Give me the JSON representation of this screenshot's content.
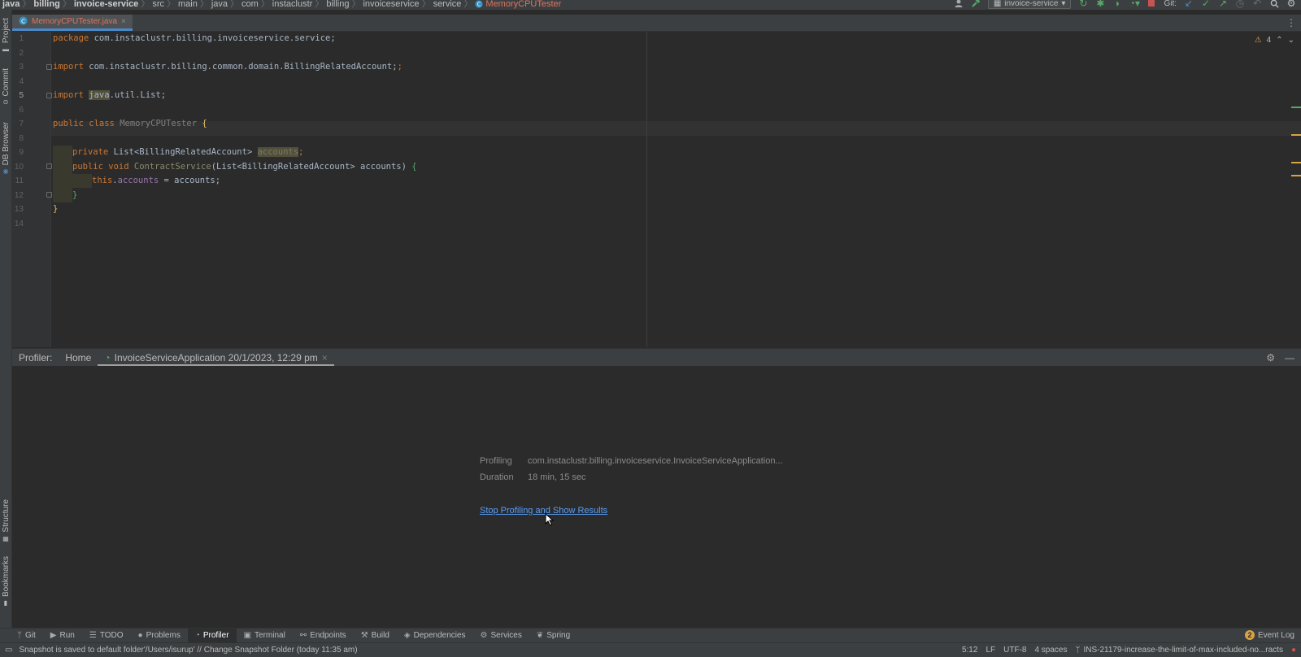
{
  "breadcrumb": [
    {
      "label": "java",
      "bold": true
    },
    {
      "label": "billing",
      "bold": true
    },
    {
      "label": "invoice-service",
      "bold": true
    },
    {
      "label": "src",
      "bold": false
    },
    {
      "label": "main",
      "bold": false
    },
    {
      "label": "java",
      "bold": false
    },
    {
      "label": "com",
      "bold": false
    },
    {
      "label": "instaclustr",
      "bold": false
    },
    {
      "label": "billing",
      "bold": false
    },
    {
      "label": "invoiceservice",
      "bold": false
    },
    {
      "label": "service",
      "bold": false
    }
  ],
  "breadcrumb_current": "MemoryCPUTester",
  "toolbar": {
    "run_config": "invoice-service",
    "git_label": "Git:"
  },
  "left_tabs": [
    "Project",
    "Commit",
    "DB Browser",
    "Structure",
    "Bookmarks"
  ],
  "editor_tab": {
    "name": "MemoryCPUTester.java",
    "close": "×"
  },
  "editor": {
    "warnings_count": "4",
    "current_line": 5,
    "line_numbers": [
      "1",
      "2",
      "3",
      "4",
      "5",
      "6",
      "7",
      "8",
      "9",
      "10",
      "11",
      "12",
      "13",
      "14"
    ]
  },
  "code": {
    "l1_kw": "package",
    "l1_rest": " com.instaclustr.billing.invoiceservice.service;",
    "l3_kw": "import",
    "l3_rest": " com.instaclustr.billing.common.domain.BillingRelatedAccount;",
    "l5_kw": "import",
    "l5_pkg": "java",
    "l5_rest": ".util.List;",
    "l7_kw": "public class",
    "l7_name": "MemoryCPUTester",
    "l7_brace": "{",
    "l9_kw": "private",
    "l9_type": " List<BillingRelatedAccount> ",
    "l9_field": "accounts",
    "l9_semi": ";",
    "l10_kw": "public void",
    "l10_name": "ContractService",
    "l10_params": "(List<BillingRelatedAccount> accounts) ",
    "l10_brace": "{",
    "l11_kw": "this",
    "l11_dot": ".",
    "l11_field": "accounts",
    "l11_rest": " = accounts;",
    "l12_brace": "}",
    "l13_brace": "}"
  },
  "profiler": {
    "label": "Profiler:",
    "home": "Home",
    "session": "InvoiceServiceApplication 20/1/2023, 12:29 pm",
    "close": "×",
    "profiling_label": "Profiling",
    "profiling_value": "com.instaclustr.billing.invoiceservice.InvoiceServiceApplication...",
    "duration_label": "Duration",
    "duration_value": "18 min, 15 sec",
    "stop_link": "Stop Profiling and Show Results"
  },
  "tool_windows": [
    {
      "label": "Git",
      "glyph": "ᛘ",
      "active": false
    },
    {
      "label": "Run",
      "glyph": "▶",
      "active": false
    },
    {
      "label": "TODO",
      "glyph": "☰",
      "active": false
    },
    {
      "label": "Problems",
      "glyph": "●",
      "active": false
    },
    {
      "label": "Profiler",
      "glyph": "◔",
      "active": true
    },
    {
      "label": "Terminal",
      "glyph": "▣",
      "active": false
    },
    {
      "label": "Endpoints",
      "glyph": "⚯",
      "active": false
    },
    {
      "label": "Build",
      "glyph": "⚒",
      "active": false
    },
    {
      "label": "Dependencies",
      "glyph": "◈",
      "active": false
    },
    {
      "label": "Services",
      "glyph": "⚙",
      "active": false
    },
    {
      "label": "Spring",
      "glyph": "❦",
      "active": false
    }
  ],
  "event_log": {
    "count": "2",
    "label": "Event Log"
  },
  "status": {
    "message": "Snapshot is saved to default folder'/Users/isurup' // Change Snapshot Folder (today 11:35 am)",
    "position": "5:12",
    "line_sep": "LF",
    "encoding": "UTF-8",
    "indent": "4 spaces",
    "branch": "INS-21179-increase-the-limit-of-max-included-no...racts"
  },
  "colors": {
    "accent": "#4a88c7",
    "link": "#589df6",
    "keyword": "#cc7832",
    "field": "#9876aa",
    "warning": "#d9a343"
  }
}
